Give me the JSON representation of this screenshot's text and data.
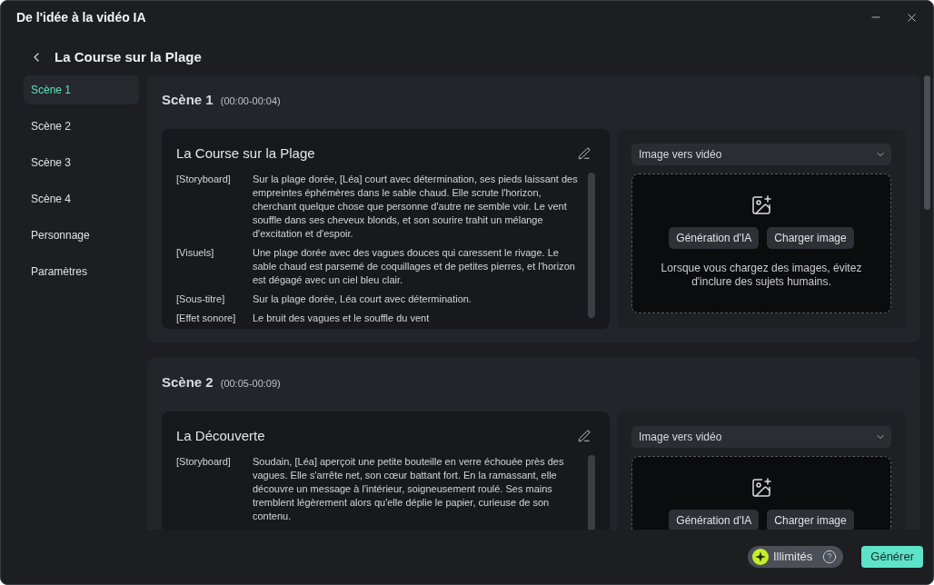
{
  "window": {
    "title": "De l'idée à la vidéo IA"
  },
  "header": {
    "title": "La Course sur la Plage"
  },
  "sidebar": {
    "items": [
      {
        "label": "Scène 1",
        "selected": true
      },
      {
        "label": "Scène 2",
        "selected": false
      },
      {
        "label": "Scène 3",
        "selected": false
      },
      {
        "label": "Scène 4",
        "selected": false
      },
      {
        "label": "Personnage",
        "selected": false
      },
      {
        "label": "Paramètres",
        "selected": false
      }
    ]
  },
  "scenes": [
    {
      "name": "Scène 1",
      "time": "(00:00-00:04)",
      "card": {
        "title": "La Course sur la Plage",
        "rows": [
          {
            "label": "[Storyboard]",
            "text": "Sur la plage dorée, [Léa] court avec détermination, ses pieds laissant des empreintes éphémères dans le sable chaud. Elle scrute l'horizon, cherchant quelque chose que personne d'autre ne semble voir. Le vent souffle dans ses cheveux blonds, et son sourire trahit un mélange d'excitation et d'espoir."
          },
          {
            "label": "[Visuels]",
            "text": "Une plage dorée avec des vagues douces qui caressent le rivage. Le sable chaud est parsemé de coquillages et de petites pierres, et l'horizon est dégagé avec un ciel bleu clair."
          },
          {
            "label": "[Sous-titre]",
            "text": "Sur la plage dorée, Léa court avec détermination."
          },
          {
            "label": "[Effet sonore]",
            "text": "Le bruit des vagues et le souffle du vent"
          }
        ]
      },
      "mode": {
        "value": "Image vers vidéo"
      },
      "upload": {
        "buttons": [
          "Génération d'IA",
          "Charger image"
        ],
        "hint": "Lorsque vous chargez des images, évitez d'inclure des sujets humains."
      }
    },
    {
      "name": "Scène 2",
      "time": "(00:05-00:09)",
      "card": {
        "title": "La Découverte",
        "rows": [
          {
            "label": "[Storyboard]",
            "text": "Soudain, [Léa] aperçoit une petite bouteille en verre échouée près des vagues. Elle s'arrête net, son cœur battant fort. En la ramassant, elle découvre un message à l'intérieur, soigneusement roulé. Ses mains tremblent légèrement alors qu'elle déplie le papier, curieuse de son contenu."
          }
        ]
      },
      "mode": {
        "value": "Image vers vidéo"
      },
      "upload": {
        "buttons": [
          "Génération d'IA",
          "Charger image"
        ]
      }
    }
  ],
  "footer": {
    "credits": {
      "label": "Illimités"
    },
    "generate_button": "Générer"
  }
}
